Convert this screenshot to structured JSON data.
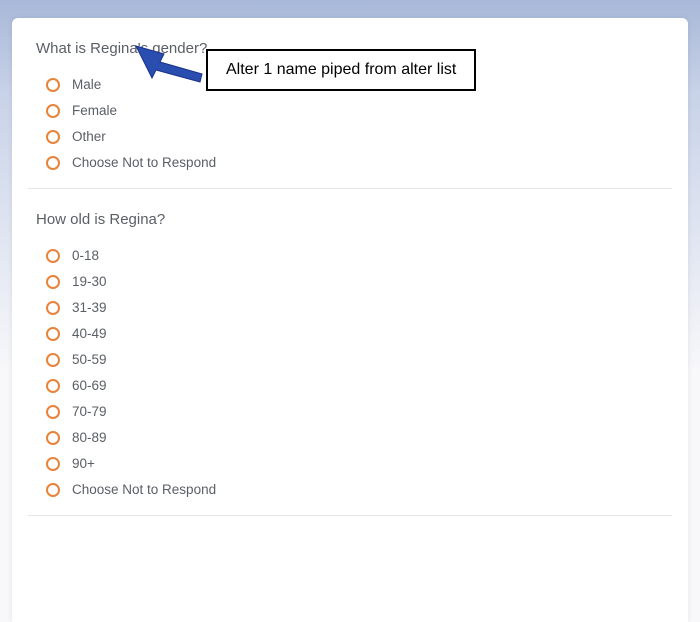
{
  "questions": [
    {
      "title": "What is Regina's gender?",
      "options": [
        {
          "label": "Male"
        },
        {
          "label": "Female"
        },
        {
          "label": "Other"
        },
        {
          "label": "Choose Not to Respond"
        }
      ]
    },
    {
      "title": "How old is Regina?",
      "options": [
        {
          "label": "0-18"
        },
        {
          "label": "19-30"
        },
        {
          "label": "31-39"
        },
        {
          "label": "40-49"
        },
        {
          "label": "50-59"
        },
        {
          "label": "60-69"
        },
        {
          "label": "70-79"
        },
        {
          "label": "80-89"
        },
        {
          "label": "90+"
        },
        {
          "label": "Choose Not to Respond"
        }
      ]
    }
  ],
  "annotation": {
    "text": "Alter 1 name piped from alter list"
  }
}
